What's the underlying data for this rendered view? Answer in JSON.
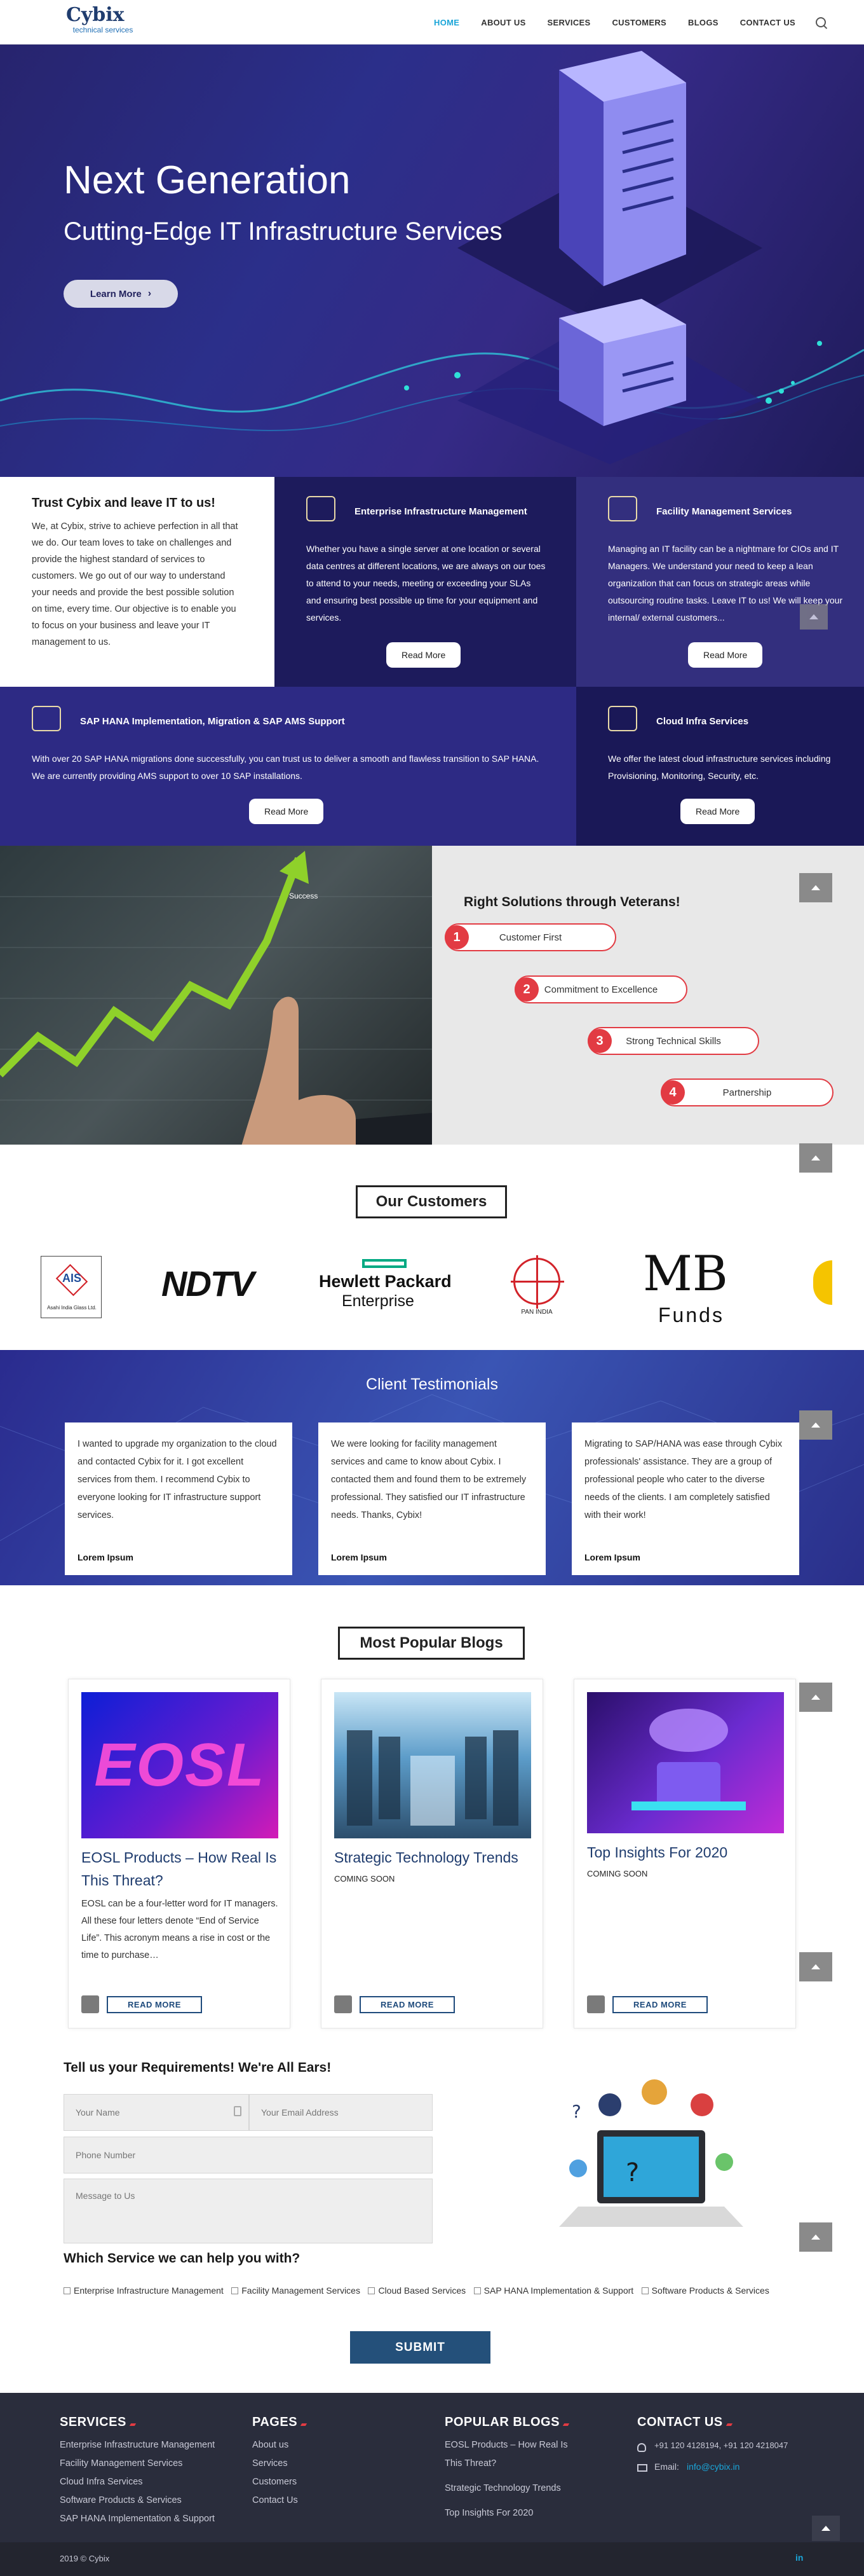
{
  "header": {
    "logo_main": "Cybix",
    "logo_sub": "technical services",
    "nav": [
      "HOME",
      "ABOUT US",
      "SERVICES",
      "CUSTOMERS",
      "BLOGS",
      "CONTACT US"
    ],
    "search_icon": "search-icon"
  },
  "hero": {
    "title": "Next Generation",
    "subtitle": "Cutting-Edge IT Infrastructure Services",
    "button": "Learn More"
  },
  "intro": {
    "title": "Trust Cybix and leave IT to us!",
    "text": "We, at Cybix, strive to achieve perfection in all that we do. Our team loves to take on challenges and provide the highest standard of services to customers. We go out of our way to understand your needs and provide the best possible solution on time, every time. Our objective is to enable you to focus on your business and leave your IT management to us."
  },
  "services": [
    {
      "title": "Enterprise Infrastructure Management",
      "text": "Whether you have a single server at one location or several data centres at different locations, we are always on our toes to attend to your needs, meeting or exceeding your SLAs and ensuring best possible up time for your equipment and services.",
      "button": "Read More"
    },
    {
      "title": "Facility Management Services",
      "text": "Managing an IT facility can be a nightmare for CIOs and IT Managers. We understand your need to keep a lean organization that can focus on strategic areas while outsourcing routine tasks. Leave IT to us! We will keep your internal/ external customers...",
      "button": "Read More"
    },
    {
      "title": "SAP HANA Implementation, Migration & SAP AMS Support",
      "text": "With over 20 SAP HANA migrations done successfully, you can trust us to deliver a smooth and flawless transition to SAP HANA. We are currently providing AMS support to over 10 SAP installations.",
      "button": "Read More"
    },
    {
      "title": "Cloud Infra Services",
      "text": "We offer the latest cloud infrastructure services including Provisioning, Monitoring, Security, etc.",
      "button": "Read More"
    }
  ],
  "veterans": {
    "title": "Right Solutions through Veterans!",
    "image_text": "Success",
    "points": [
      {
        "num": "1",
        "label": "Customer First"
      },
      {
        "num": "2",
        "label": "Commitment to Excellence"
      },
      {
        "num": "3",
        "label": "Strong Technical Skills"
      },
      {
        "num": "4",
        "label": "Partnership"
      }
    ]
  },
  "customers": {
    "title": "Our Customers",
    "logos": [
      {
        "name": "AIS",
        "sub": "Asahi India Glass Ltd."
      },
      {
        "name": "NDTV"
      },
      {
        "name": "Hewlett Packard",
        "sub": "Enterprise"
      },
      {
        "name": "PAN INDIA"
      },
      {
        "name": "MB",
        "sub": "Funds"
      }
    ]
  },
  "testimonials": {
    "title": "Client Testimonials",
    "items": [
      {
        "text": "I wanted to upgrade my organization to the cloud and contacted Cybix for it. I got excellent services from them. I recommend Cybix to everyone looking for IT infrastructure support services.",
        "author": "Lorem Ipsum"
      },
      {
        "text": "We were looking for facility management services and came to know about Cybix. I contacted them and found them to be extremely professional. They satisfied our IT infrastructure needs. Thanks, Cybix!",
        "author": "Lorem Ipsum"
      },
      {
        "text": "Migrating to SAP/HANA was ease through Cybix professionals' assistance. They are a group of professional people who cater to the diverse needs of the clients. I am completely satisfied with their work!",
        "author": "Lorem Ipsum"
      }
    ]
  },
  "blogs": {
    "title": "Most Popular Blogs",
    "items": [
      {
        "image_text": "EOSL",
        "title": "EOSL Products – How Real Is This Threat?",
        "meta": "",
        "excerpt": "EOSL can be a four-letter word for IT managers. All these four letters denote “End of Service Life”. This acronym means a rise in cost or the time to purchase…",
        "button": "READ MORE"
      },
      {
        "title": "Strategic Technology Trends",
        "meta": "COMING SOON",
        "excerpt": "",
        "button": "READ MORE"
      },
      {
        "title": "Top Insights For 2020",
        "meta": "COMING SOON",
        "excerpt": "",
        "button": "READ MORE"
      }
    ]
  },
  "form": {
    "title": "Tell us your Requirements! We're All Ears!",
    "name_placeholder": "Your Name",
    "email_placeholder": "Your Email Address",
    "phone_placeholder": "Phone Number",
    "message_placeholder": "Message to Us",
    "services_title": "Which Service we can help you with?",
    "options": [
      "Enterprise Infrastructure Management",
      "Facility Management Services",
      "Cloud Based Services",
      "SAP HANA Implementation & Support",
      "Software Products & Services"
    ],
    "submit": "SUBMIT"
  },
  "footer": {
    "services_title": "SERVICES",
    "services": [
      "Enterprise Infrastructure Management",
      "Facility Management Services",
      "Cloud Infra Services",
      "Software Products & Services",
      "SAP HANA Implementation & Support"
    ],
    "pages_title": "PAGES",
    "pages": [
      "About us",
      "Services",
      "Customers",
      "Contact Us"
    ],
    "blogs_title": "POPULAR BLOGS",
    "blogs": [
      "EOSL Products – How Real Is This Threat?",
      "Strategic Technology Trends",
      "Top Insights For 2020"
    ],
    "contact_title": "CONTACT US",
    "phone": "+91 120 4128194, +91 120 4218047",
    "email_label": "Email:",
    "email": "info@cybix.in",
    "copyright": "2019 © Cybix",
    "social": "in"
  },
  "colors": {
    "brand": "#1f3c6e",
    "accent": "#1aa5d8",
    "red": "#e23b43",
    "card_dark": "#1d1b5c",
    "card_purple": "#332f7e"
  }
}
